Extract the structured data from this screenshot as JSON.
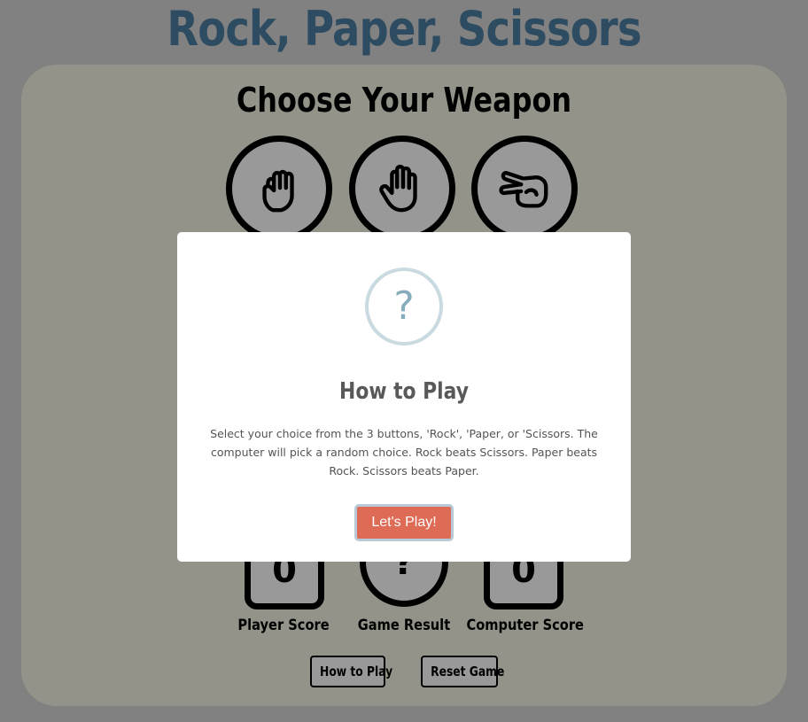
{
  "page": {
    "title": "Rock, Paper, Scissors"
  },
  "panel": {
    "heading": "Choose Your Weapon",
    "weapons": [
      {
        "name": "Rock",
        "icon": "fist-hand-icon"
      },
      {
        "name": "Paper",
        "icon": "open-hand-icon"
      },
      {
        "name": "Scissors",
        "icon": "scissors-hand-icon"
      }
    ]
  },
  "scoreboard": {
    "player_score": "0",
    "player_label": "Player Score",
    "game_result": "?",
    "game_result_label": "Game Result",
    "computer_score": "0",
    "computer_label": "Computer Score"
  },
  "footer": {
    "how_to_play_label": "How to Play",
    "reset_label": "Reset Game"
  },
  "modal": {
    "icon": "?",
    "title": "How to Play",
    "text": "Select your choice from the 3 buttons, 'Rock', 'Paper, or 'Scissors. The computer will pick a random choice. Rock beats Scissors. Paper beats Rock. Scissors beats Paper.",
    "button_label": "Let's Play!"
  },
  "colors": {
    "title": "#4d7fa2",
    "panel_background": "#f6f5e4",
    "page_background": "#d7d7d7",
    "modal_button": "#dd6b55",
    "modal_icon": "#87adbd"
  }
}
